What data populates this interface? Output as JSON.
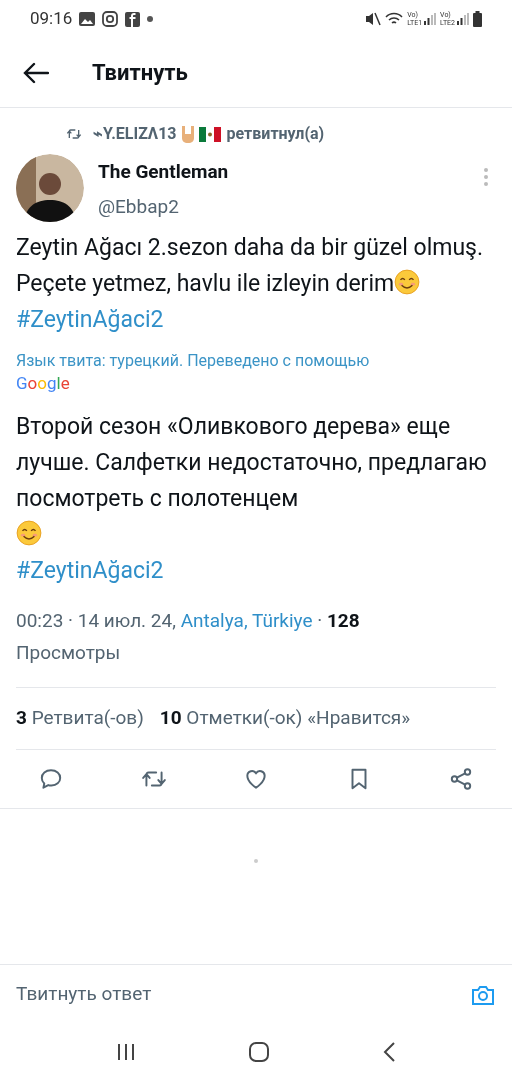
{
  "status_bar": {
    "time": "09:16",
    "sim_labels": [
      {
        "top": "Vo)",
        "bottom": "LTE1"
      },
      {
        "top": "Vo)",
        "bottom": "LTE2"
      }
    ]
  },
  "header": {
    "title": "Твитнуть"
  },
  "retweet": {
    "name": "⌁Y.ELIZΛ13",
    "suffix": "ретвитнул(а)"
  },
  "author": {
    "name": "The Gentleman",
    "handle": "@Ebbap2"
  },
  "tweet": {
    "text": "Zeytin Ağacı 2.sezon daha da bir güzel olmuş. Peçete yetmez, havlu ile izleyin derim",
    "hashtag": "#ZeytinAğaci2"
  },
  "translation": {
    "note": "Язык твита: турецкий. Переведено с помощью",
    "brand": "Google",
    "text": "Второй сезон «Оливкового дерева» еще лучше. Салфетки недостаточно, предлагаю посмотреть с полотенцем",
    "hashtag": "#ZeytinAğaci2"
  },
  "meta": {
    "time": "00:23 · 14 июл. 24, ",
    "place": "Antalya, Türkiye",
    "sep": " · ",
    "views": "128",
    "views_label": "Просмотры"
  },
  "stats": [
    {
      "count": "3",
      "label": "Ретвита(-ов)"
    },
    {
      "count": "10",
      "label": "Отметки(-ок) «Нравится»"
    }
  ],
  "actions": [
    {
      "kind": "reply"
    },
    {
      "kind": "retweet"
    },
    {
      "kind": "like"
    },
    {
      "kind": "bookmark"
    },
    {
      "kind": "share"
    }
  ],
  "reply_field": {
    "placeholder": "Твитнуть ответ"
  }
}
